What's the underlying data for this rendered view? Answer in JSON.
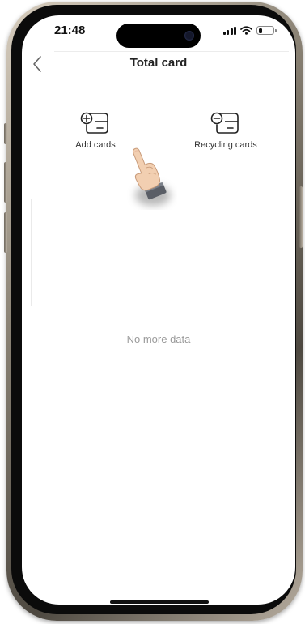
{
  "status_bar": {
    "time": "21:48",
    "battery_level": 0.3
  },
  "header": {
    "title": "Total card",
    "back_icon": "chevron-left-icon"
  },
  "actions": [
    {
      "label": "Add cards",
      "icon": "add-card-icon"
    },
    {
      "label": "Recycling cards",
      "icon": "remove-card-icon"
    }
  ],
  "list": {
    "empty_text": "No more data"
  },
  "overlay": {
    "cursor_icon": "pointing-hand-icon"
  },
  "colors": {
    "text_primary": "#222222",
    "text_muted": "#9a9a9a",
    "icon_stroke": "#222222"
  }
}
